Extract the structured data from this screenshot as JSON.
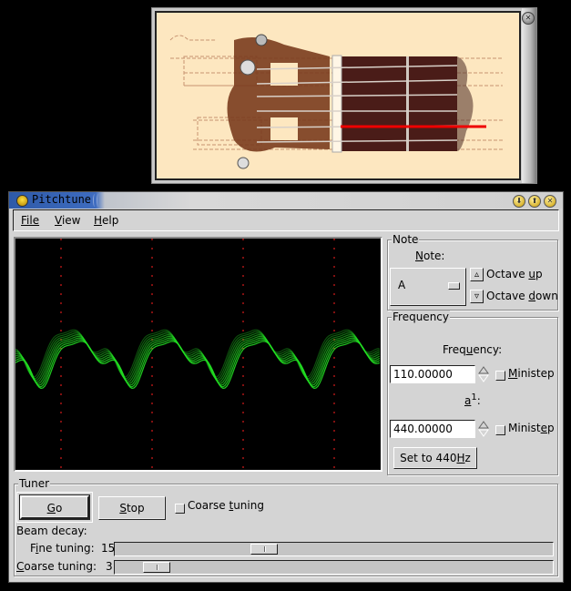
{
  "popup": {
    "close_icon": "close-icon",
    "image": "guitar-headstock-with-highlighted-string"
  },
  "window": {
    "title": "Pitchtune",
    "buttons": [
      "minimize-icon",
      "maximize-icon",
      "close-icon"
    ]
  },
  "menu": {
    "file": "File",
    "view": "View",
    "help": "Help"
  },
  "note_group": {
    "title": "Note",
    "label": "Note:",
    "selected": "A",
    "octave_up": "Octave up",
    "octave_down": "Octave down"
  },
  "frequency_group": {
    "title": "Frequency",
    "freq_label": "Frequency:",
    "freq_value": "110.00000",
    "ministep_label": "Ministep",
    "a1_label": "a",
    "a1_superscript": "1",
    "a1_suffix": ":",
    "a1_value": "440.00000",
    "ministep2_label": "Ministep",
    "set_button": "Set to 440Hz"
  },
  "tuner_group": {
    "title": "Tuner",
    "go": "Go",
    "stop": "Stop",
    "coarse_checkbox": "Coarse tuning",
    "beam_decay": "Beam decay:",
    "fine_label": "Fine tuning:",
    "fine_value": "15",
    "coarse_label": "Coarse tuning:",
    "coarse_value": "3",
    "fine_fraction": 0.15,
    "coarse_fraction": 0.03
  },
  "scope": {
    "trace_color": "#22dd22",
    "marker_color": "#ff2020",
    "marker_count": 4
  }
}
